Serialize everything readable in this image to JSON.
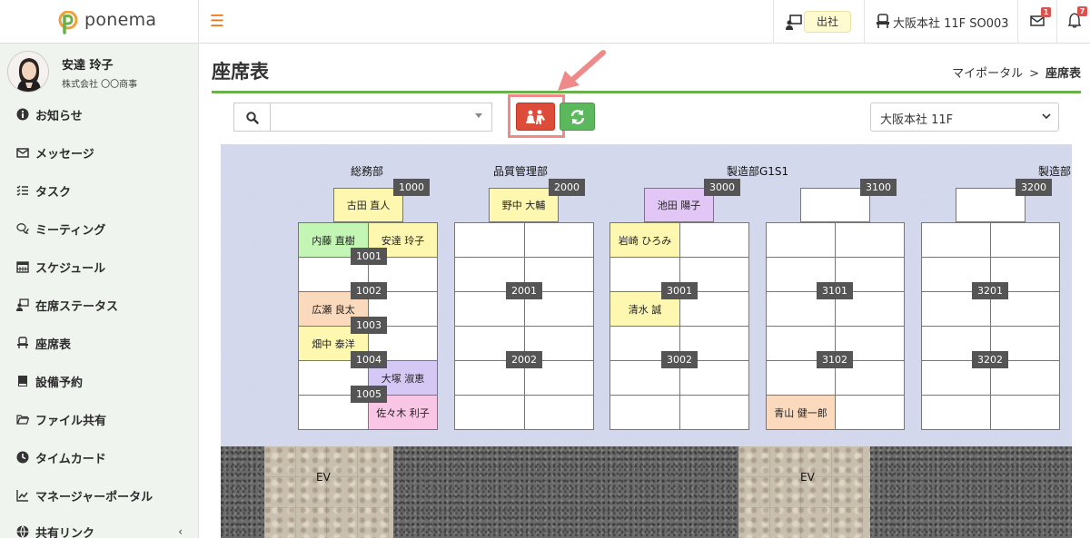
{
  "header": {
    "logo_text": "ponema",
    "attendance_status": "出社",
    "location": "大阪本社 11F SO003",
    "mail_count": "1",
    "bell_count": "7",
    "brand_color": "#e8761e"
  },
  "user": {
    "name": "安達 玲子",
    "company": "株式会社 〇〇商事"
  },
  "sidebar": {
    "items": [
      {
        "label": "お知らせ",
        "icon": "info-icon"
      },
      {
        "label": "メッセージ",
        "icon": "envelope-icon"
      },
      {
        "label": "タスク",
        "icon": "checklist-icon"
      },
      {
        "label": "ミーティング",
        "icon": "chat-icon"
      },
      {
        "label": "スケジュール",
        "icon": "calendar-icon"
      },
      {
        "label": "在席ステータス",
        "icon": "presence-icon"
      },
      {
        "label": "座席表",
        "icon": "seat-icon"
      },
      {
        "label": "設備予約",
        "icon": "book-icon"
      },
      {
        "label": "ファイル共有",
        "icon": "folder-icon"
      },
      {
        "label": "タイムカード",
        "icon": "clock-icon"
      },
      {
        "label": "マネージャーポータル",
        "icon": "chart-icon"
      },
      {
        "label": "共有リンク",
        "icon": "globe-icon"
      }
    ]
  },
  "page": {
    "title": "座席表",
    "breadcrumb_parent": "マイポータル",
    "breadcrumb_sep": ">",
    "breadcrumb_current": "座席表"
  },
  "toolbar": {
    "search_value": "",
    "floor_selected": "大阪本社 11F",
    "seat_button_color": "#dd4b39",
    "refresh_button_color": "#5cb85c"
  },
  "map": {
    "departments": [
      "総務部",
      "品質管理部",
      "製造部G1S1",
      "製造部"
    ],
    "seat_tags": [
      "1000",
      "1001",
      "1002",
      "1003",
      "1004",
      "1005",
      "2000",
      "2001",
      "2002",
      "3000",
      "3001",
      "3002",
      "3100",
      "3101",
      "3102",
      "3200",
      "3201",
      "3202"
    ],
    "people": {
      "p1000": "古田 直人",
      "p1001a": "内藤 直樹",
      "p1001b": "安達 玲子",
      "p1003a": "広瀬 良太",
      "p1004a": "畑中 泰洋",
      "p1005b": "大塚 淑恵",
      "p1006b": "佐々木 利子",
      "p2000": "野中 大輔",
      "p3000": "池田 陽子",
      "p3001a": "岩崎 ひろみ",
      "p3003a": "清水 誠",
      "p3106a": "青山 健一郎"
    },
    "elevator_label": "EV",
    "seat_colors": {
      "yellow": "#fdf7b0",
      "green": "#c3f5b5",
      "peach": "#fad9bd",
      "purple": "#d6c8f5",
      "lavender": "#e2c6f6",
      "pink": "#f9c6e6"
    }
  }
}
